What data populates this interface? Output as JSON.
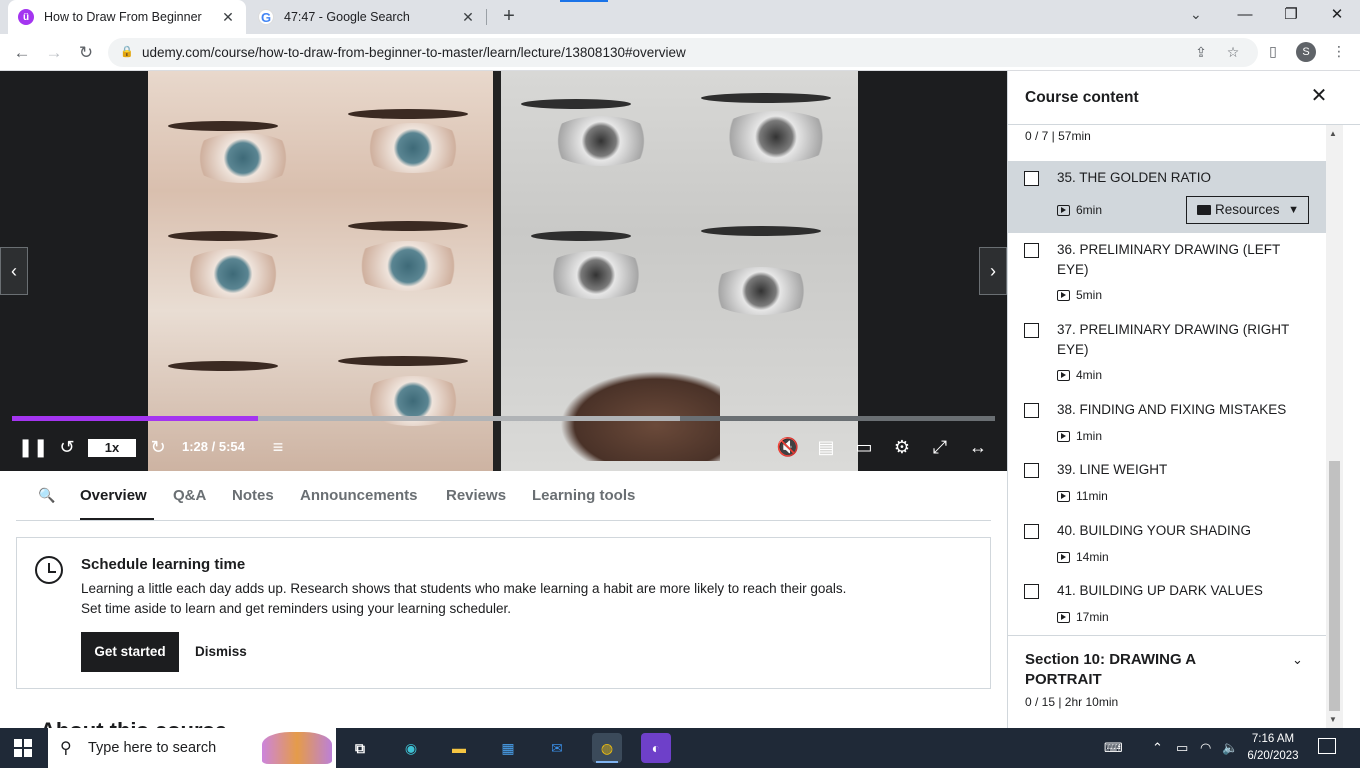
{
  "browser": {
    "tabs": [
      {
        "title": "How to Draw From Beginner to Master",
        "favicon": "udemy-icon",
        "active": true
      },
      {
        "title": "47:47 - Google Search",
        "favicon": "google-icon",
        "active": false
      }
    ],
    "url": "udemy.com/course/how-to-draw-from-beginner-to-master/learn/lecture/13808130#overview",
    "profile_initial": "S"
  },
  "player": {
    "speed": "1x",
    "time": "1:28 / 5:54",
    "progress_fraction": 0.25,
    "buffer_fraction": 0.68
  },
  "lecture_tabs": [
    "Overview",
    "Q&A",
    "Notes",
    "Announcements",
    "Reviews",
    "Learning tools"
  ],
  "scheduler": {
    "title": "Schedule learning time",
    "line1": "Learning a little each day adds up. Research shows that students who make learning a habit are more likely to reach their goals.",
    "line2": "Set time aside to learn and get reminders using your learning scheduler.",
    "primary": "Get started",
    "secondary": "Dismiss"
  },
  "about_heading": "About this course",
  "sidebar": {
    "title": "Course content",
    "section_summary": "0 / 7 | 57min",
    "lessons": [
      {
        "title": "35. THE GOLDEN RATIO",
        "duration": "6min",
        "current": true
      },
      {
        "title": "36. PRELIMINARY DRAWING (LEFT EYE)",
        "duration": "5min"
      },
      {
        "title": "37. PRELIMINARY DRAWING (RIGHT EYE)",
        "duration": "4min"
      },
      {
        "title": "38. FINDING AND FIXING MISTAKES",
        "duration": "1min"
      },
      {
        "title": "39. LINE WEIGHT",
        "duration": "11min"
      },
      {
        "title": "40. BUILDING YOUR SHADING",
        "duration": "14min"
      },
      {
        "title": "41. BUILDING UP DARK VALUES",
        "duration": "17min"
      }
    ],
    "resources_label": "Resources",
    "next_section": {
      "title": "Section 10: DRAWING A PORTRAIT",
      "meta": "0 / 15 | 2hr 10min"
    }
  },
  "taskbar": {
    "search_placeholder": "Type here to search",
    "time": "7:16 AM",
    "date": "6/20/2023"
  },
  "colors": {
    "udemy_purple": "#a435f0",
    "dark": "#1c1d1f",
    "taskbar": "#1f2937"
  }
}
